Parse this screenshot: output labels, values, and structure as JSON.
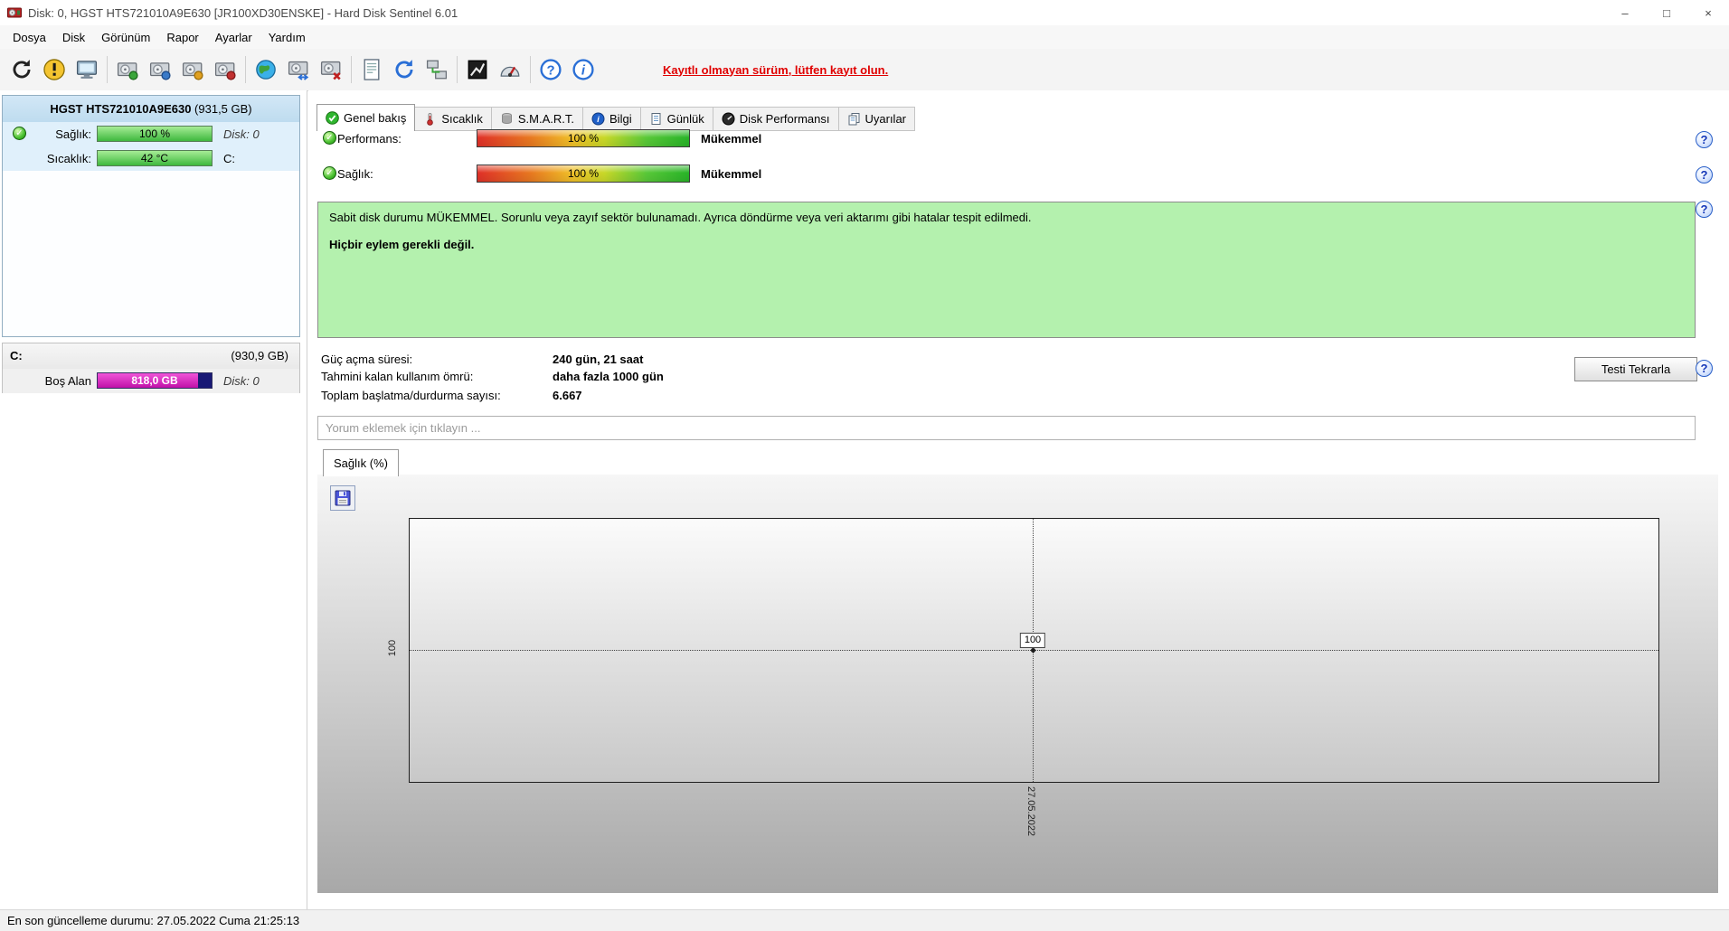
{
  "icons": {
    "check_glyph": "✓",
    "help_glyph": "?",
    "minimize_glyph": "–",
    "maximize_glyph": "□",
    "close_glyph": "×"
  },
  "window": {
    "title": "Disk: 0, HGST HTS721010A9E630 [JR100XD30ENSKE]  -  Hard Disk Sentinel 6.01"
  },
  "menu": {
    "items": [
      {
        "label": "Dosya"
      },
      {
        "label": "Disk"
      },
      {
        "label": "Görünüm"
      },
      {
        "label": "Rapor"
      },
      {
        "label": "Ayarlar"
      },
      {
        "label": "Yardım"
      }
    ]
  },
  "toolbar": {
    "register_link": "Kayıtlı olmayan sürüm, lütfen kayıt olun."
  },
  "sidebar": {
    "disk": {
      "name": "HGST HTS721010A9E630",
      "size": " (931,5 GB)",
      "health_label": "Sağlık:",
      "health_value": "100 %",
      "health_disk": "Disk: 0",
      "temp_label": "Sıcaklık:",
      "temp_value": "42 °C",
      "temp_partition": "C:"
    },
    "partition": {
      "name": "C:",
      "size": "(930,9 GB)",
      "free_label": "Boş Alan",
      "free_value": "818,0 GB",
      "disk": "Disk: 0"
    }
  },
  "tabs": {
    "items": [
      {
        "label": "Genel bakış"
      },
      {
        "label": "Sıcaklık"
      },
      {
        "label": "S.M.A.R.T."
      },
      {
        "label": "Bilgi"
      },
      {
        "label": "Günlük"
      },
      {
        "label": "Disk Performansı"
      },
      {
        "label": "Uyarılar"
      }
    ]
  },
  "overview": {
    "performance_label": "Performans:",
    "performance_value": "100 %",
    "performance_rating": "Mükemmel",
    "health_label": "Sağlık:",
    "health_value": "100 %",
    "health_rating": "Mükemmel",
    "status_text": "Sabit disk durumu MÜKEMMEL. Sorunlu veya zayıf sektör bulunamadı. Ayrıca döndürme veya veri aktarımı gibi hatalar tespit edilmedi.",
    "action_text": "Hiçbir eylem gerekli değil.",
    "stats": [
      {
        "label": "Güç açma süresi:",
        "value": "240 gün, 21 saat"
      },
      {
        "label": "Tahmini kalan kullanım ömrü:",
        "value": "daha fazla 1000 gün"
      },
      {
        "label": "Toplam başlatma/durdurma sayısı:",
        "value": "6.667"
      }
    ],
    "retest_button": "Testi Tekrarla",
    "comment_placeholder": "Yorum eklemek için tıklayın ..."
  },
  "chart": {
    "tab_label": "Sağlık (%)"
  },
  "chart_data": {
    "type": "line",
    "title": "Sağlık (%)",
    "x": [
      "27.05.2022"
    ],
    "series": [
      {
        "name": "Sağlık",
        "values": [
          100
        ]
      }
    ],
    "point_label": "100",
    "ylabel_tick": "100",
    "grid": "dotted crosshair at data point",
    "legend": "none"
  },
  "statusbar": {
    "text": "En son güncelleme durumu: 27.05.2022 Cuma 21:25:13"
  }
}
